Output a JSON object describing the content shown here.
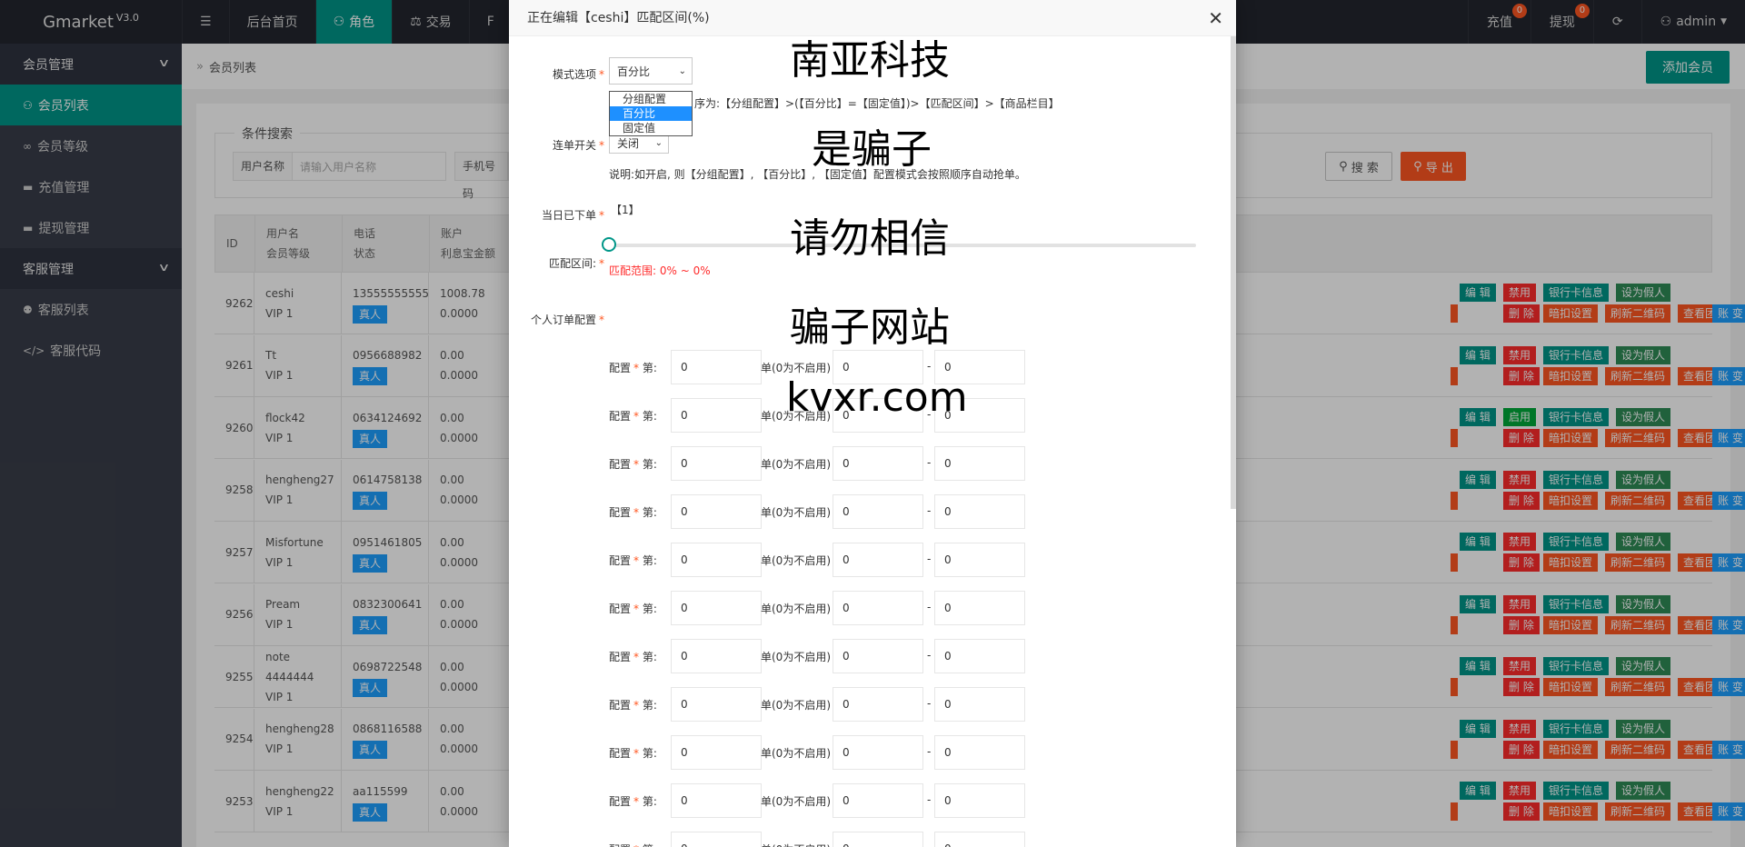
{
  "brand": {
    "name": "Gmarket",
    "version": "V3.0"
  },
  "topnav": [
    {
      "icon": "☰",
      "label": ""
    },
    {
      "icon": "",
      "label": "后台首页"
    },
    {
      "icon": "⚇",
      "label": "角色"
    },
    {
      "icon": "⚖",
      "label": "交易"
    },
    {
      "icon": "",
      "label": "F"
    }
  ],
  "topright": {
    "recharge": "充值",
    "recharge_badge": "0",
    "withdraw": "提现",
    "withdraw_badge": "0",
    "refresh": "⟳",
    "user": "admin"
  },
  "sidebar": {
    "group1": "会员管理",
    "items1": [
      "会员列表",
      "会员等级",
      "充值管理",
      "提现管理"
    ],
    "group2": "客服管理",
    "items2": [
      "客服列表",
      "客服代码"
    ]
  },
  "breadcrumb": "会员列表",
  "add_member": "添加会员",
  "search": {
    "legend": "条件搜索",
    "username_label": "用户名称",
    "username_placeholder": "请输入用户名称",
    "phone_label": "手机号码",
    "search_btn": "搜 索",
    "export_btn": "导 出"
  },
  "table": {
    "headers": [
      {
        "a": "ID",
        "b": ""
      },
      {
        "a": "用户名",
        "b": "会员等级"
      },
      {
        "a": "电话",
        "b": "状态"
      },
      {
        "a": "账户",
        "b": "利息宝金额"
      }
    ],
    "rows": [
      {
        "id": "9262",
        "name": "ceshi",
        "level": "VIP 1",
        "phone": "13555555555",
        "status": "真人",
        "bal": "1008.78",
        "interest": "0.0000",
        "toggle": "禁用"
      },
      {
        "id": "9261",
        "name": "Tt",
        "level": "VIP 1",
        "phone": "0956688982",
        "status": "真人",
        "bal": "0.00",
        "interest": "0.0000",
        "toggle": "禁用"
      },
      {
        "id": "9260",
        "name": "flock42",
        "level": "VIP 1",
        "phone": "0634124692",
        "status": "真人",
        "bal": "0.00",
        "interest": "0.0000",
        "toggle": "启用"
      },
      {
        "id": "9258",
        "name": "hengheng27",
        "level": "VIP 1",
        "phone": "0614758138",
        "status": "真人",
        "bal": "0.00",
        "interest": "0.0000",
        "toggle": "禁用"
      },
      {
        "id": "9257",
        "name": "Misfortune",
        "level": "VIP 1",
        "phone": "0951461805",
        "status": "真人",
        "bal": "0.00",
        "interest": "0.0000",
        "toggle": "禁用"
      },
      {
        "id": "9256",
        "name": "Pream",
        "level": "VIP 1",
        "phone": "0832300641",
        "status": "真人",
        "bal": "0.00",
        "interest": "0.0000",
        "toggle": "禁用"
      },
      {
        "id": "9255",
        "name": "note 4444444",
        "level": "VIP 1",
        "phone": "0698722548",
        "status": "真人",
        "bal": "0.00",
        "interest": "0.0000",
        "toggle": "禁用"
      },
      {
        "id": "9254",
        "name": "hengheng28",
        "level": "VIP 1",
        "phone": "0868116588",
        "status": "真人",
        "bal": "0.00",
        "interest": "0.0000",
        "toggle": "禁用"
      },
      {
        "id": "9253",
        "name": "hengheng22",
        "level": "VIP 1",
        "phone": "aa115599",
        "status": "真人",
        "bal": "0.00",
        "interest": "0.0000",
        "toggle": "禁用"
      }
    ],
    "actions": {
      "edit": "编 辑",
      "bank": "银行卡信息",
      "fake": "设为假人",
      "delete": "删 除",
      "deduct": "暗扣设置",
      "qr": "刷新二维码",
      "team": "查看团队",
      "ledger": "账 变"
    }
  },
  "modal": {
    "title": "正在编辑【ceshi】匹配区间(%)",
    "mode_label": "模式选项",
    "mode_value": "百分比",
    "mode_options": [
      "分组配置",
      "百分比",
      "固定值"
    ],
    "priority_note": "序为:【分组配置】>(【百分比】=【固定值】)>【匹配区间】>【商品栏目】",
    "continuous_label": "连单开关",
    "continuous_value": "关闭",
    "continuous_note": "说明:如开启, 则【分组配置】, 【百分比】, 【固定值】配置模式会按照顺序自动抢单。",
    "today_label": "当日已下单",
    "today_value": "【1】",
    "range_label": "匹配区间:",
    "range_note": "匹配范围: 0% ~ 0%",
    "personal_label": "个人订单配置",
    "cfg_label": "配置",
    "cfg_nth": "第:",
    "cfg_unit": "单(0为不启用)",
    "cfg_dash": "-",
    "cfg_value": "0"
  },
  "watermark": [
    "南亚科技",
    "是骗子",
    "请勿相信",
    "骗子网站",
    "kvxr.com"
  ]
}
